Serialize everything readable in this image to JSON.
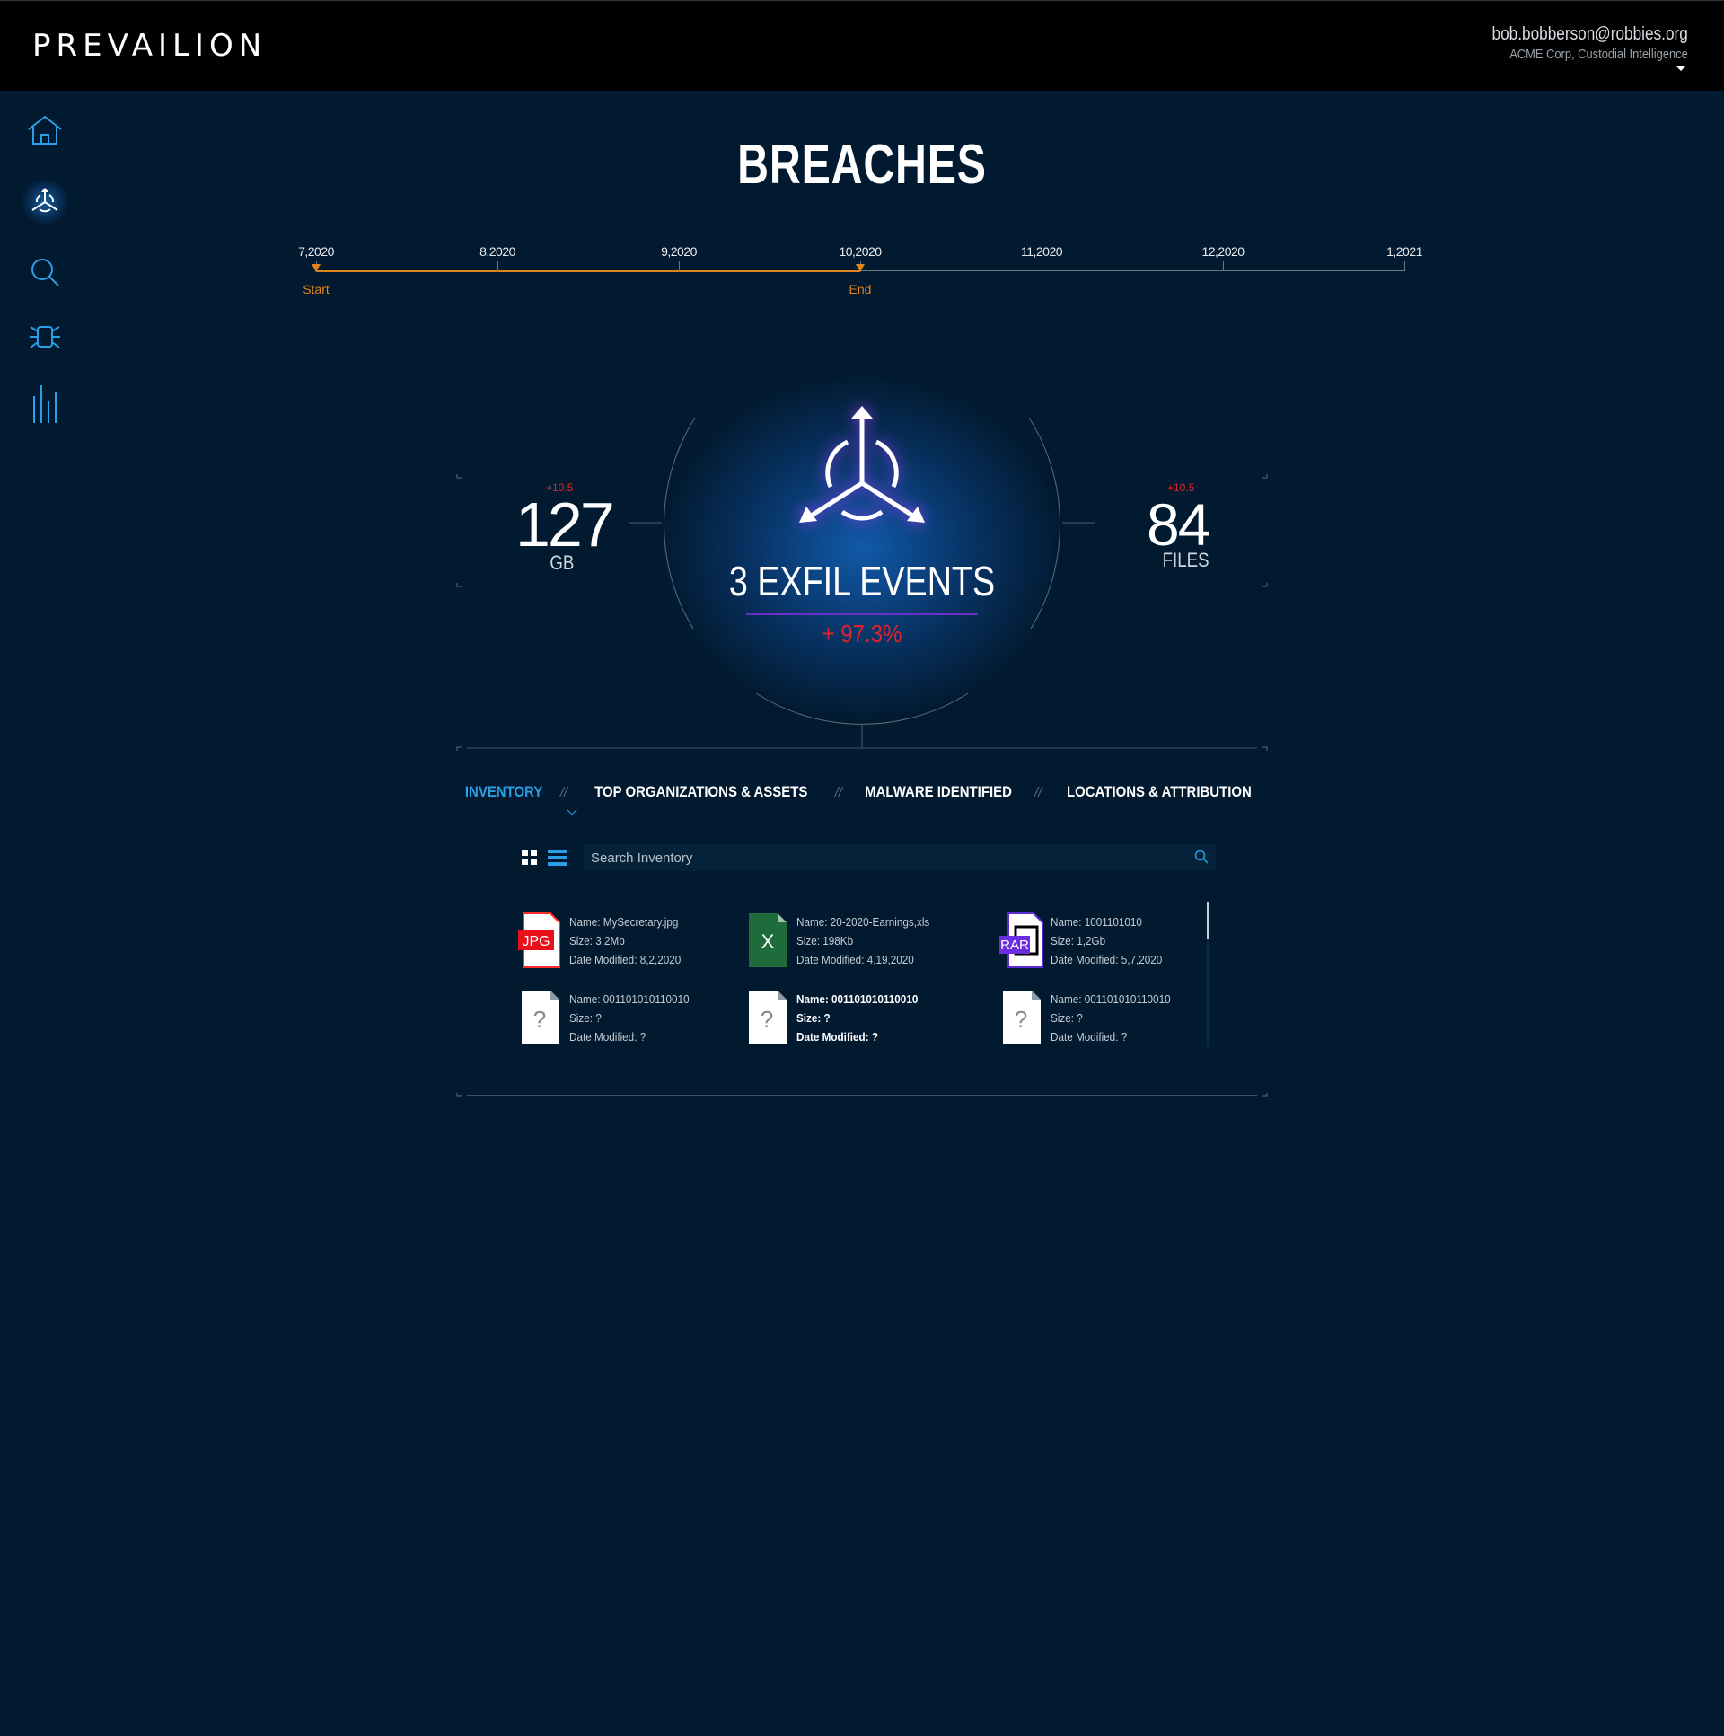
{
  "header": {
    "logo": "PREVAILION",
    "user_email": "bob.bobberson@robbies.org",
    "user_org": "ACME Corp, Custodial Intelligence"
  },
  "sidebar": {
    "items": [
      {
        "icon": "home-icon",
        "active": false
      },
      {
        "icon": "breaches-icon",
        "active": true
      },
      {
        "icon": "search-icon",
        "active": false
      },
      {
        "icon": "malware-bug-icon",
        "active": false
      },
      {
        "icon": "bar-chart-icon",
        "active": false
      }
    ]
  },
  "page": {
    "title": "BREACHES"
  },
  "timeline": {
    "labels": [
      "7,2020",
      "8,2020",
      "9,2020",
      "10,2020",
      "11,2020",
      "12,2020",
      "1,2021"
    ],
    "start_label": "Start",
    "end_label": "End",
    "selected_start": "7,2020",
    "selected_end": "10,2020",
    "accent_color": "#e0841c"
  },
  "stats": {
    "left": {
      "value": "127",
      "unit": "GB",
      "delta": "+10.5"
    },
    "right": {
      "value": "84",
      "unit": "FILES",
      "delta": "+10.5"
    },
    "events": {
      "count": "3",
      "label": "EXFIL EVENTS",
      "delta": "+ 97.3%"
    },
    "delta_color": "#e0222c"
  },
  "tabs": [
    {
      "label": "INVENTORY",
      "active": true
    },
    {
      "label": "TOP ORGANIZATIONS & ASSETS",
      "active": false
    },
    {
      "label": "MALWARE IDENTIFIED",
      "active": false
    },
    {
      "label": "LOCATIONS & ATTRIBUTION",
      "active": false
    }
  ],
  "tab_separator": "//",
  "inventory": {
    "search_placeholder": "Search Inventory",
    "files": [
      {
        "type": "jpg",
        "badge": "JPG",
        "name": "Name: MySecretary.jpg",
        "size": "Size: 3,2Mb",
        "modified": "Date Modified: 8,2,2020",
        "bold": false
      },
      {
        "type": "xls",
        "badge": "X",
        "name": "Name: 20-2020-Earnings,xls",
        "size": "Size: 198Kb",
        "modified": "Date Modified: 4,19,2020",
        "bold": false
      },
      {
        "type": "rar",
        "badge": "RAR",
        "name": "Name: 1001101010",
        "size": "Size: 1,2Gb",
        "modified": "Date Modified: 5,7,2020",
        "bold": false
      },
      {
        "type": "unknown",
        "badge": "?",
        "name": "Name: 001101010110010",
        "size": "Size: ?",
        "modified": "Date Modified: ?",
        "bold": false
      },
      {
        "type": "unknown",
        "badge": "?",
        "name": "Name: 001101010110010",
        "size": "Size: ?",
        "modified": "Date Modified: ?",
        "bold": true
      },
      {
        "type": "unknown",
        "badge": "?",
        "name": "Name: 001101010110010",
        "size": "Size: ?",
        "modified": "Date Modified: ?",
        "bold": false
      }
    ]
  },
  "colors": {
    "background": "#021a30",
    "accent_blue": "#2a9ee6",
    "purple": "#6c2fc9"
  }
}
